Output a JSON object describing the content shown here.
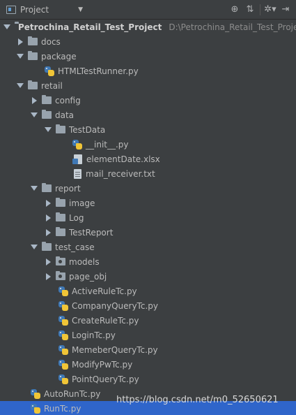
{
  "toolbar": {
    "title": "Project",
    "icons": [
      "globe-icon",
      "collapse-icon",
      "settings-icon",
      "hide-icon"
    ]
  },
  "tree": {
    "root": {
      "label": "Petrochina_Retail_Test_Project",
      "path": "D:\\Petrochina_Retail_Test_Project"
    },
    "items": [
      {
        "label": "docs"
      },
      {
        "label": "package"
      },
      {
        "label": "HTMLTestRunner.py"
      },
      {
        "label": "retail"
      },
      {
        "label": "config"
      },
      {
        "label": "data"
      },
      {
        "label": "TestData"
      },
      {
        "label": "__init__.py"
      },
      {
        "label": "elementDate.xlsx"
      },
      {
        "label": "mail_receiver.txt"
      },
      {
        "label": "report"
      },
      {
        "label": "image"
      },
      {
        "label": "Log"
      },
      {
        "label": "TestReport"
      },
      {
        "label": "test_case"
      },
      {
        "label": "models"
      },
      {
        "label": "page_obj"
      },
      {
        "label": "ActiveRuleTc.py"
      },
      {
        "label": "CompanyQueryTc.py"
      },
      {
        "label": "CreateRuleTc.py"
      },
      {
        "label": "LoginTc.py"
      },
      {
        "label": "MemeberQueryTc.py"
      },
      {
        "label": "ModifyPwTc.py"
      },
      {
        "label": "PointQueryTc.py"
      },
      {
        "label": "AutoRunTc.py"
      },
      {
        "label": "RunTc.py"
      }
    ]
  },
  "watermark": "https://blog.csdn.net/m0_52650621"
}
